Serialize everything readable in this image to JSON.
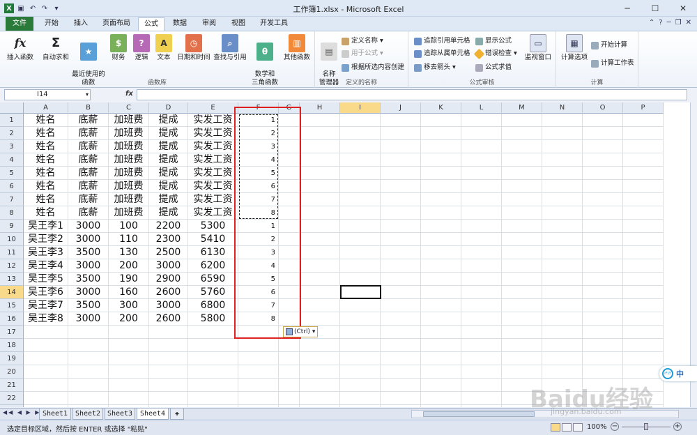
{
  "window": {
    "title": "工作簿1.xlsx - Microsoft Excel"
  },
  "ribbon_tabs": [
    "文件",
    "开始",
    "插入",
    "页面布局",
    "公式",
    "数据",
    "审阅",
    "视图",
    "开发工具"
  ],
  "active_tab": "公式",
  "groups": {
    "function_library": {
      "label": "函数库",
      "buttons": [
        "插入函数",
        "自动求和",
        "最近使用的\n函数",
        "财务",
        "逻辑",
        "文本",
        "日期和时间",
        "查找与引用",
        "数学和\n三角函数",
        "其他函数"
      ]
    },
    "defined_names": {
      "label": "定义的名称",
      "name_manager": "名称\n管理器",
      "define_name": "定义名称",
      "use_in_formula": "用于公式",
      "create_from_selection": "根据所选内容创建"
    },
    "formula_auditing": {
      "label": "公式审核",
      "trace_precedents": "追踪引用单元格",
      "trace_dependents": "追踪从属单元格",
      "remove_arrows": "移去箭头",
      "show_formulas": "显示公式",
      "error_checking": "错误检查",
      "evaluate_formula": "公式求值",
      "watch_window": "监视窗口"
    },
    "calculation": {
      "label": "计算",
      "calc_options": "计算选项",
      "calc_now": "开始计算",
      "calc_sheet": "计算工作表"
    }
  },
  "formula_bar": {
    "name_box": "I14",
    "fx": "fx",
    "formula": ""
  },
  "columns": [
    "A",
    "B",
    "C",
    "D",
    "E",
    "F",
    "G",
    "H",
    "I",
    "J",
    "K",
    "L",
    "M",
    "N",
    "O",
    "P"
  ],
  "selected_column": "I",
  "selected_row": 14,
  "rows": [
    [
      "姓名",
      "底薪",
      "加班费",
      "提成",
      "实发工资",
      "1"
    ],
    [
      "姓名",
      "底薪",
      "加班费",
      "提成",
      "实发工资",
      "2"
    ],
    [
      "姓名",
      "底薪",
      "加班费",
      "提成",
      "实发工资",
      "3"
    ],
    [
      "姓名",
      "底薪",
      "加班费",
      "提成",
      "实发工资",
      "4"
    ],
    [
      "姓名",
      "底薪",
      "加班费",
      "提成",
      "实发工资",
      "5"
    ],
    [
      "姓名",
      "底薪",
      "加班费",
      "提成",
      "实发工资",
      "6"
    ],
    [
      "姓名",
      "底薪",
      "加班费",
      "提成",
      "实发工资",
      "7"
    ],
    [
      "姓名",
      "底薪",
      "加班费",
      "提成",
      "实发工资",
      "8"
    ],
    [
      "吴王李1",
      "3000",
      "100",
      "2200",
      "5300",
      "1"
    ],
    [
      "吴王李2",
      "3000",
      "110",
      "2300",
      "5410",
      "2"
    ],
    [
      "吴王李3",
      "3500",
      "130",
      "2500",
      "6130",
      "3"
    ],
    [
      "吴王李4",
      "3000",
      "200",
      "3000",
      "6200",
      "4"
    ],
    [
      "吴王李5",
      "3500",
      "190",
      "2900",
      "6590",
      "5"
    ],
    [
      "吴王李6",
      "3000",
      "160",
      "2600",
      "5760",
      "6"
    ],
    [
      "吴王李7",
      "3500",
      "300",
      "3000",
      "6800",
      "7"
    ],
    [
      "吴王李8",
      "3000",
      "200",
      "2600",
      "5800",
      "8"
    ]
  ],
  "row_count": 24,
  "paste_options": "(Ctrl)",
  "sheets": [
    "Sheet1",
    "Sheet2",
    "Sheet3",
    "Sheet4"
  ],
  "active_sheet": "Sheet4",
  "status": {
    "message": "选定目标区域，然后按 ENTER 或选择 \"粘贴\"",
    "zoom": "100%"
  },
  "watermark": {
    "text": "Baidu经验",
    "url": "jingyan.baidu.com"
  },
  "ime": {
    "label": "中"
  }
}
